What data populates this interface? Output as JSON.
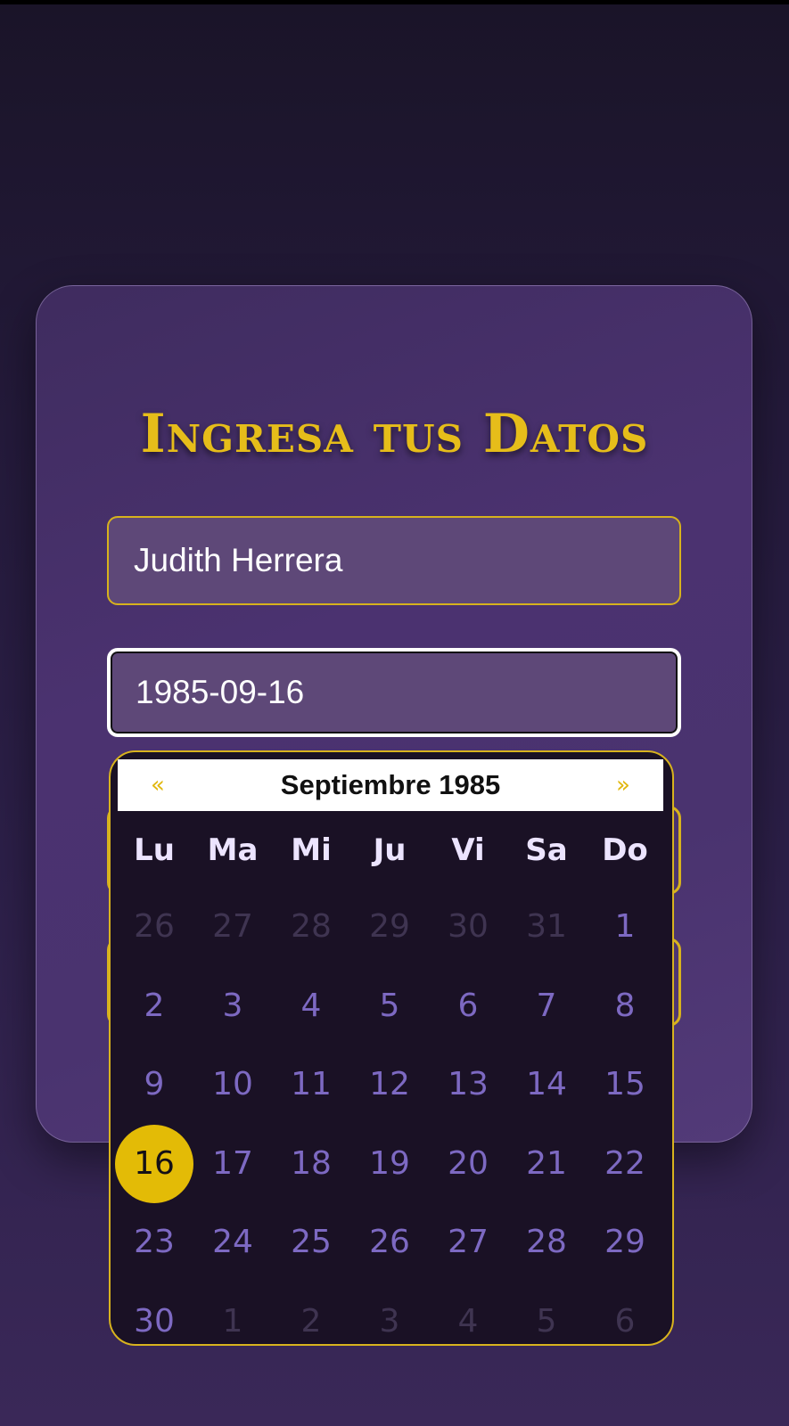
{
  "form": {
    "title": "Ingresa tus Datos",
    "name_value": "Judith Herrera",
    "birthdate_value": "1985-09-16"
  },
  "calendar": {
    "prev_label": "«",
    "next_label": "»",
    "month_year": "Septiembre 1985",
    "weekdays": [
      "Lu",
      "Ma",
      "Mi",
      "Ju",
      "Vi",
      "Sa",
      "Do"
    ],
    "selected_day": "16",
    "weeks": [
      [
        {
          "d": "26",
          "other": true
        },
        {
          "d": "27",
          "other": true
        },
        {
          "d": "28",
          "other": true
        },
        {
          "d": "29",
          "other": true
        },
        {
          "d": "30",
          "other": true
        },
        {
          "d": "31",
          "other": true
        },
        {
          "d": "1",
          "other": false
        }
      ],
      [
        {
          "d": "2",
          "other": false
        },
        {
          "d": "3",
          "other": false
        },
        {
          "d": "4",
          "other": false
        },
        {
          "d": "5",
          "other": false
        },
        {
          "d": "6",
          "other": false
        },
        {
          "d": "7",
          "other": false
        },
        {
          "d": "8",
          "other": false
        }
      ],
      [
        {
          "d": "9",
          "other": false
        },
        {
          "d": "10",
          "other": false
        },
        {
          "d": "11",
          "other": false
        },
        {
          "d": "12",
          "other": false
        },
        {
          "d": "13",
          "other": false
        },
        {
          "d": "14",
          "other": false
        },
        {
          "d": "15",
          "other": false
        }
      ],
      [
        {
          "d": "16",
          "other": false
        },
        {
          "d": "17",
          "other": false
        },
        {
          "d": "18",
          "other": false
        },
        {
          "d": "19",
          "other": false
        },
        {
          "d": "20",
          "other": false
        },
        {
          "d": "21",
          "other": false
        },
        {
          "d": "22",
          "other": false
        }
      ],
      [
        {
          "d": "23",
          "other": false
        },
        {
          "d": "24",
          "other": false
        },
        {
          "d": "25",
          "other": false
        },
        {
          "d": "26",
          "other": false
        },
        {
          "d": "27",
          "other": false
        },
        {
          "d": "28",
          "other": false
        },
        {
          "d": "29",
          "other": false
        }
      ],
      [
        {
          "d": "30",
          "other": false
        },
        {
          "d": "1",
          "other": true
        },
        {
          "d": "2",
          "other": true
        },
        {
          "d": "3",
          "other": true
        },
        {
          "d": "4",
          "other": true
        },
        {
          "d": "5",
          "other": true
        },
        {
          "d": "6",
          "other": true
        }
      ]
    ]
  },
  "colors": {
    "accent_gold": "#e3bb06",
    "card_purple": "#4b3270",
    "day_text": "#7d69c2",
    "calendar_bg": "#1a1125"
  }
}
